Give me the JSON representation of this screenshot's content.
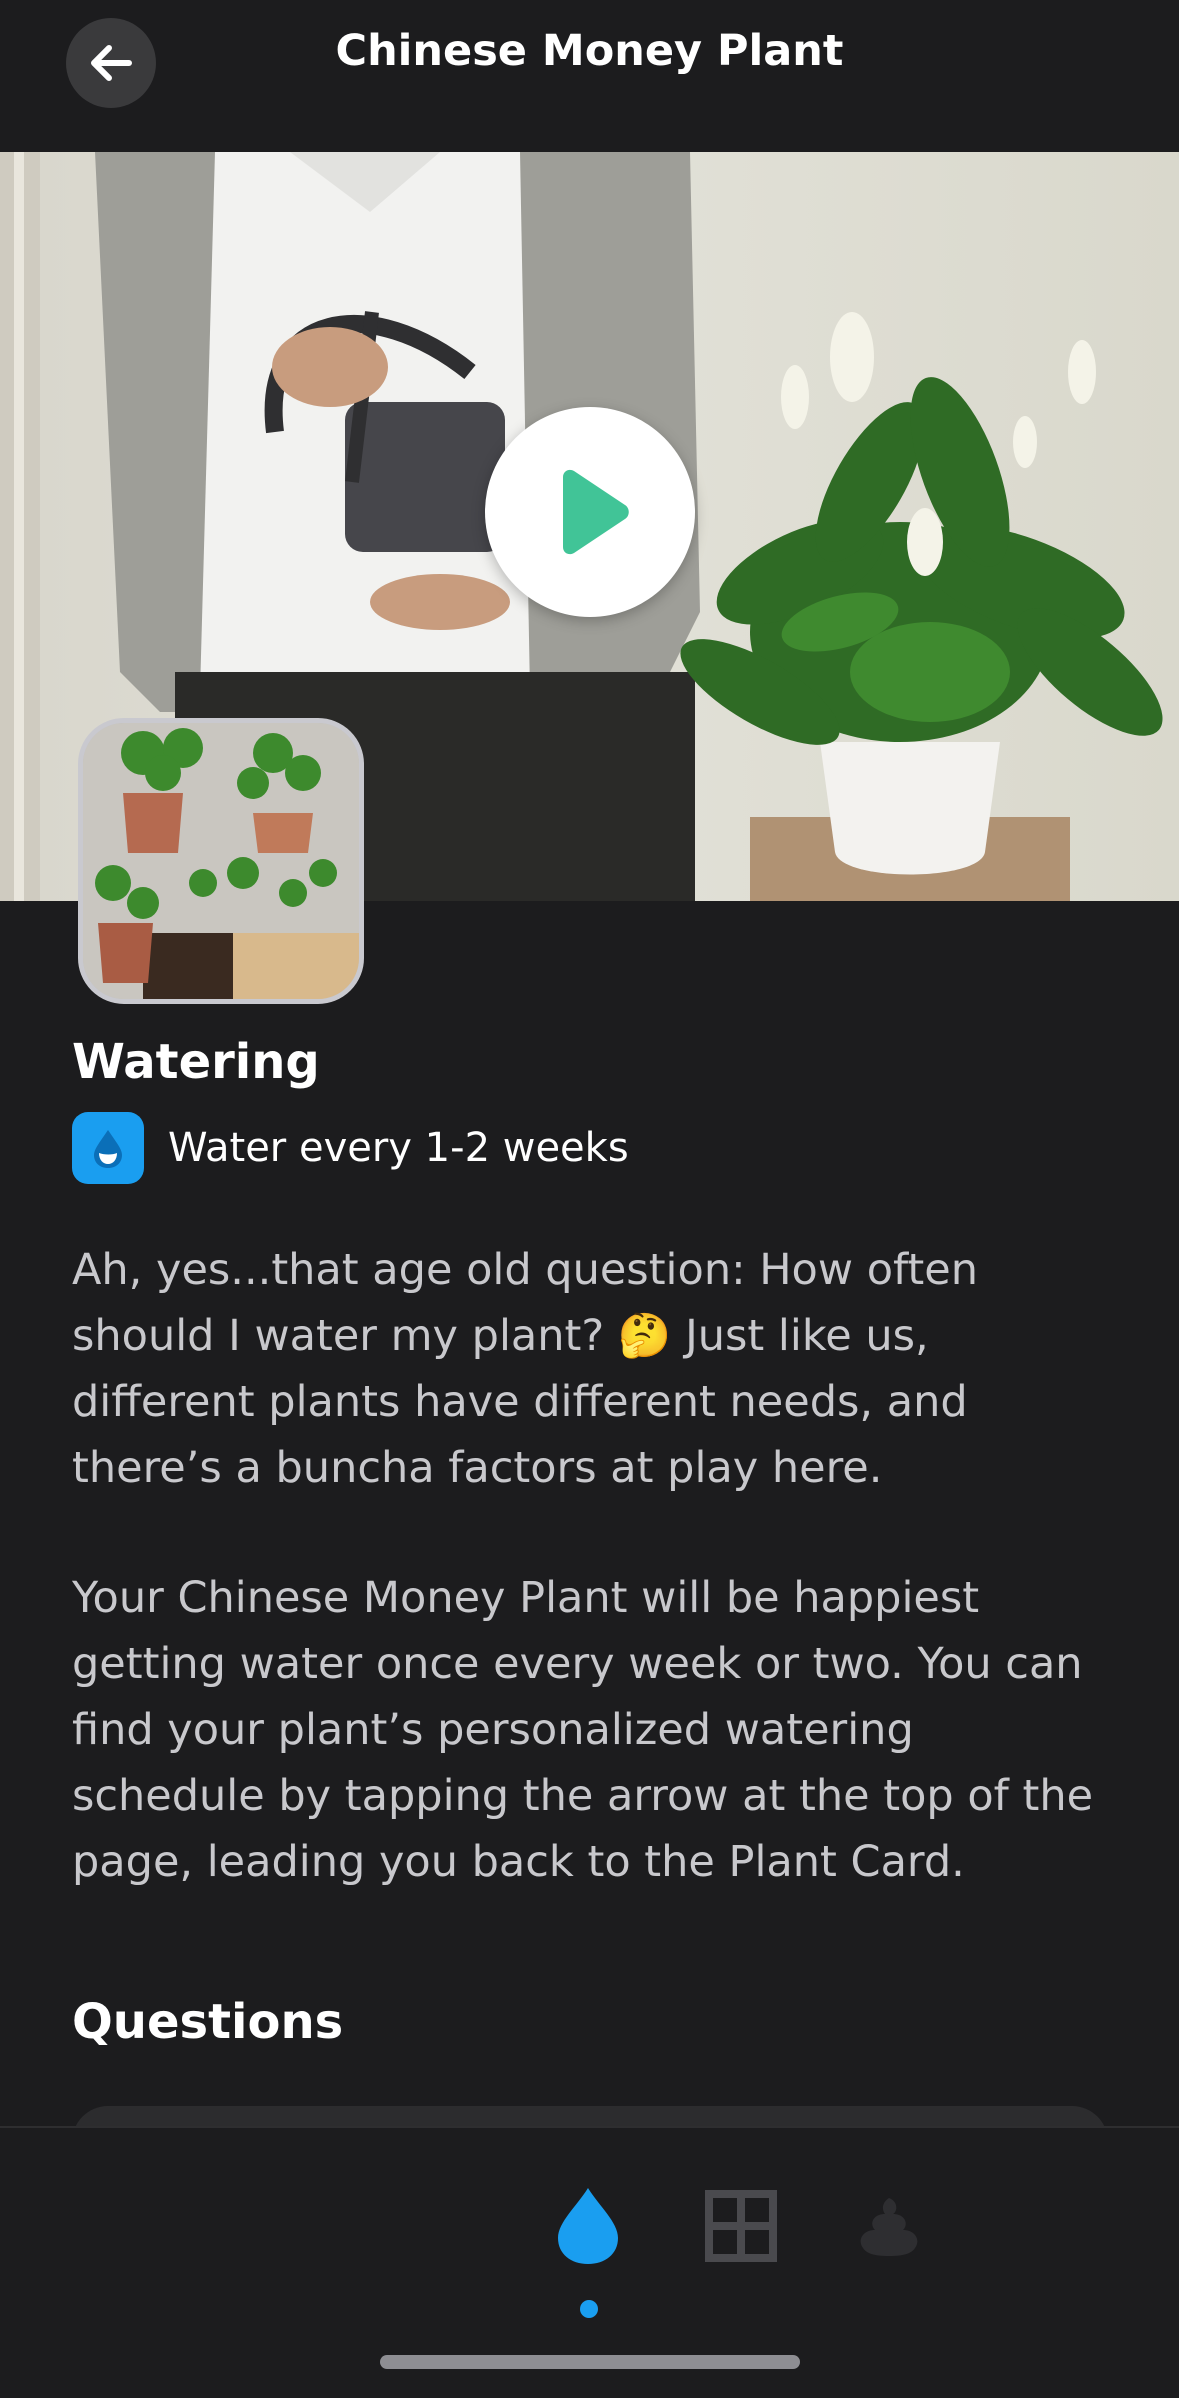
{
  "header": {
    "title": "Chinese Money Plant",
    "back_icon": "arrow-left-icon"
  },
  "hero": {
    "play_icon": "play-icon",
    "play_color": "#41c497"
  },
  "thumbnail": {
    "alt": "Chinese Money Plant photo"
  },
  "watering": {
    "heading": "Watering",
    "badge_icon": "water-drop-icon",
    "badge_color": "#1a9ef0",
    "frequency": "Water every 1-2 weeks",
    "paragraph1": "Ah, yes...that age old question: How often should I water my plant? 🤔 Just like us, different plants have different needs, and there’s a buncha factors at play here.",
    "paragraph2": "Your Chinese Money Plant will be happiest getting water once every week or two. You can find your plant’s personalized watering schedule by tapping the arrow at the top of the page, leading you back to the Plant Card."
  },
  "questions": {
    "heading": "Questions"
  },
  "tabbar": {
    "tabs": [
      {
        "icon": "water-drop-icon",
        "active": true
      },
      {
        "icon": "window-icon",
        "active": false
      },
      {
        "icon": "poop-icon",
        "active": false
      }
    ],
    "active_color": "#1a9ef0"
  }
}
